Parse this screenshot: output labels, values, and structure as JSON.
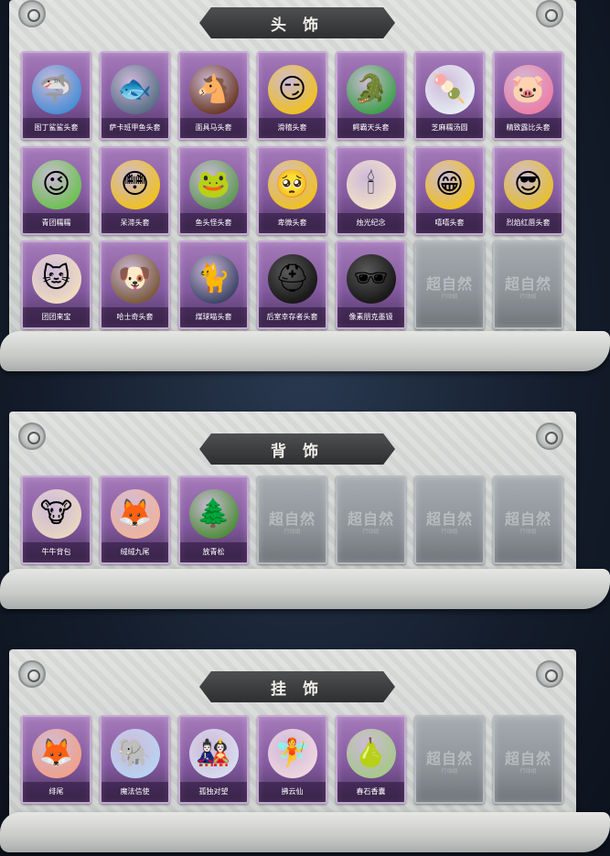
{
  "sections": [
    {
      "title": "头 饰",
      "rows": [
        [
          {
            "label": "图丁鲨鲨头套",
            "icon": "shark-head-icon",
            "glyph": "🦈",
            "color": "#4a8fd6"
          },
          {
            "label": "萨卡班甲鱼头套",
            "icon": "fish-head-icon",
            "glyph": "🐟",
            "color": "#5a6f86"
          },
          {
            "label": "面具马头套",
            "icon": "horse-head-icon",
            "glyph": "🐴",
            "color": "#6b3a24"
          },
          {
            "label": "滑稽头套",
            "icon": "smirk-face-icon",
            "glyph": "😏",
            "color": "#f2c21c"
          },
          {
            "label": "鳄霸天头套",
            "icon": "crocodile-head-icon",
            "glyph": "🐊",
            "color": "#3ea24a"
          },
          {
            "label": "芝麻糯汤圆",
            "icon": "dumpling-head-icon",
            "glyph": "🍡",
            "color": "#e8eef5"
          },
          {
            "label": "精致露比头套",
            "icon": "pink-creature-icon",
            "glyph": "🐷",
            "color": "#ef7fa8"
          }
        ],
        [
          {
            "label": "青团糯糯",
            "icon": "green-bun-icon",
            "glyph": "😉",
            "color": "#6cc24f"
          },
          {
            "label": "呆滞头套",
            "icon": "stunned-face-icon",
            "glyph": "😳",
            "color": "#f2c21c"
          },
          {
            "label": "鱼头怪头套",
            "icon": "fish-monster-icon",
            "glyph": "🐸",
            "color": "#5f9a54"
          },
          {
            "label": "卑微头套",
            "icon": "humble-face-icon",
            "glyph": "🥺",
            "color": "#f2c21c"
          },
          {
            "label": "烛光纪念",
            "icon": "candle-head-icon",
            "glyph": "🕯",
            "color": "#f4e2c8"
          },
          {
            "label": "嘻嘻头套",
            "icon": "grin-face-icon",
            "glyph": "😁",
            "color": "#f2c21c"
          },
          {
            "label": "烈焰红唇头套",
            "icon": "yellow-creature-icon",
            "glyph": "😎",
            "color": "#e8c12a"
          }
        ],
        [
          {
            "label": "团团来宝",
            "icon": "cream-cat-icon",
            "glyph": "🐱",
            "color": "#f1dcc0"
          },
          {
            "label": "哈士奇头套",
            "icon": "husky-head-icon",
            "glyph": "🐶",
            "color": "#7a5a3c"
          },
          {
            "label": "煤球喵头套",
            "icon": "black-cat-icon",
            "glyph": "🐈",
            "color": "#3d4466"
          },
          {
            "label": "后室幸存者头套",
            "icon": "gas-mask-helmet-icon",
            "glyph": "⛑",
            "color": "#1a1a1a",
            "dark": true
          },
          {
            "label": "像素朋克墨镜",
            "icon": "pixel-sunglasses-icon",
            "glyph": "🕶",
            "color": "#1a1a1a",
            "dark": true
          },
          {
            "empty": true
          },
          {
            "empty": true
          }
        ]
      ]
    },
    {
      "title": "背 饰",
      "rows": [
        [
          {
            "label": "牛牛背包",
            "icon": "cow-backpack-icon",
            "glyph": "🐮",
            "color": "#e9d7c2"
          },
          {
            "label": "绒绒九尾",
            "icon": "nine-tail-fox-icon",
            "glyph": "🦊",
            "color": "#f2b49a"
          },
          {
            "label": "放青松",
            "icon": "potted-pine-icon",
            "glyph": "🌲",
            "color": "#4f8f3a"
          },
          {
            "empty": true
          },
          {
            "empty": true
          },
          {
            "empty": true
          },
          {
            "empty": true
          }
        ]
      ]
    },
    {
      "title": "挂 饰",
      "rows": [
        [
          {
            "label": "绯尾",
            "icon": "fox-charm-icon",
            "glyph": "🦊",
            "color": "#f2a28a"
          },
          {
            "label": "魔法信使",
            "icon": "elephant-charm-icon",
            "glyph": "🐘",
            "color": "#b9d4f2"
          },
          {
            "label": "孤独对望",
            "icon": "doll-charm-icon",
            "glyph": "🎎",
            "color": "#d8dcef"
          },
          {
            "label": "拂云仙",
            "icon": "fairy-charm-icon",
            "glyph": "🧚",
            "color": "#f0d6e0"
          },
          {
            "label": "春石香囊",
            "icon": "sachet-charm-icon",
            "glyph": "🍐",
            "color": "#a8c98a"
          },
          {
            "empty": true
          },
          {
            "empty": true
          }
        ]
      ]
    }
  ],
  "empty_slot": {
    "watermark": "超自然",
    "watermark_sub": "行动组"
  }
}
